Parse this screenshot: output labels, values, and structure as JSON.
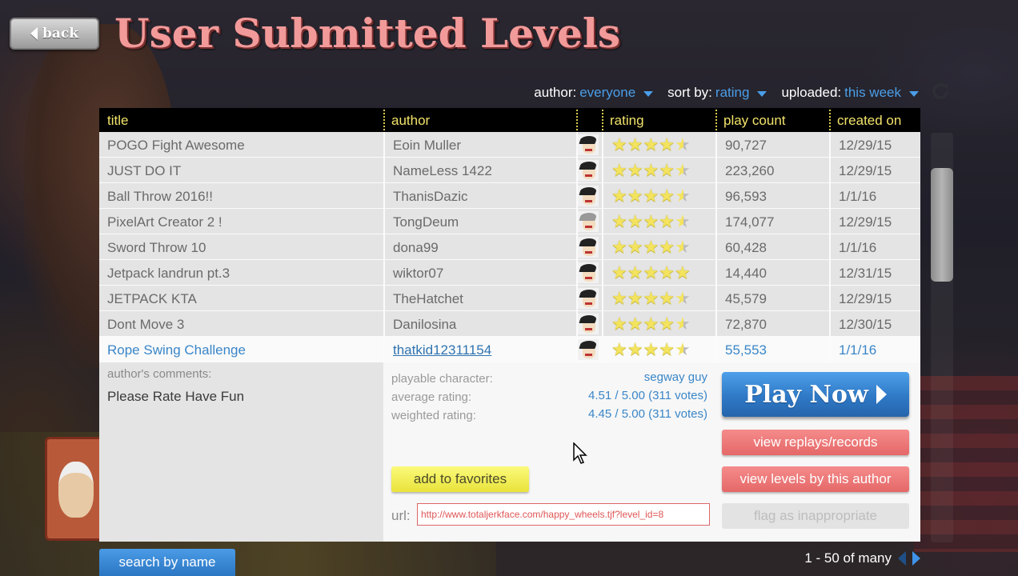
{
  "header": {
    "back_label": "back",
    "title": "User Submitted Levels"
  },
  "filters": {
    "author_label": "author:",
    "author_value": "everyone",
    "sort_label": "sort by:",
    "sort_value": "rating",
    "uploaded_label": "uploaded:",
    "uploaded_value": "this week"
  },
  "table": {
    "columns": [
      "title",
      "author",
      "rating",
      "play count",
      "created on"
    ],
    "rows": [
      {
        "title": "POGO Fight Awesome",
        "author": "Eoin Muller",
        "plays": "90,727",
        "created": "12/29/15",
        "stars": 4.5,
        "avatar": "irresponsible-dad"
      },
      {
        "title": "JUST DO IT",
        "author": "NameLess 1422",
        "plays": "223,260",
        "created": "12/29/15",
        "stars": 4.5,
        "avatar": "irresponsible-dad"
      },
      {
        "title": "Ball Throw 2016!!",
        "author": "ThanisDazic",
        "plays": "96,593",
        "created": "1/1/16",
        "stars": 4.5,
        "avatar": "irresponsible-dad"
      },
      {
        "title": "PixelArt Creator 2 !",
        "author": "TongDeum",
        "plays": "174,077",
        "created": "12/29/15",
        "stars": 4.5,
        "avatar": "old-man"
      },
      {
        "title": "Sword Throw 10",
        "author": "dona99",
        "plays": "60,428",
        "created": "1/1/16",
        "stars": 4.5,
        "avatar": "irresponsible-dad"
      },
      {
        "title": "Jetpack landrun pt.3",
        "author": "wiktor07",
        "plays": "14,440",
        "created": "12/31/15",
        "stars": 5,
        "avatar": "irresponsible-dad"
      },
      {
        "title": "JETPACK KTA",
        "author": "TheHatchet",
        "plays": "45,579",
        "created": "12/29/15",
        "stars": 4.5,
        "avatar": "irresponsible-dad"
      },
      {
        "title": "Dont Move 3",
        "author": "Danilosina",
        "plays": "72,870",
        "created": "12/30/15",
        "stars": 4.5,
        "avatar": "irresponsible-dad"
      },
      {
        "title": "Rope Swing Challenge",
        "author": "thatkid12311154",
        "plays": "55,553",
        "created": "1/1/16",
        "stars": 4.5,
        "avatar": "irresponsible-dad",
        "selected": true
      }
    ]
  },
  "detail": {
    "comments_label": "author's comments:",
    "comments_text": "Please Rate Have Fun",
    "character_label": "playable character:",
    "character_value": "segway guy",
    "avg_label": "average rating:",
    "avg_value": "4.51 / 5.00 (311 votes)",
    "weighted_label": "weighted rating:",
    "weighted_value": "4.45 / 5.00 (311 votes)",
    "favorites_label": "add to favorites",
    "url_label": "url:",
    "url_value": "http://www.totaljerkface.com/happy_wheels.tjf?level_id=8",
    "play_label": "Play Now",
    "replays_label": "view replays/records",
    "author_levels_label": "view levels by this author",
    "flag_label": "flag as inappropriate"
  },
  "footer": {
    "search_label": "search by name",
    "pagination_text": "1 - 50 of many"
  },
  "colors": {
    "title": "#f29a9a",
    "header_text": "#f2e36a",
    "link_blue": "#4a9ee8",
    "play_blue": "#2f79c6",
    "red_button": "#e56868",
    "yellow_button": "#e9e33b"
  }
}
